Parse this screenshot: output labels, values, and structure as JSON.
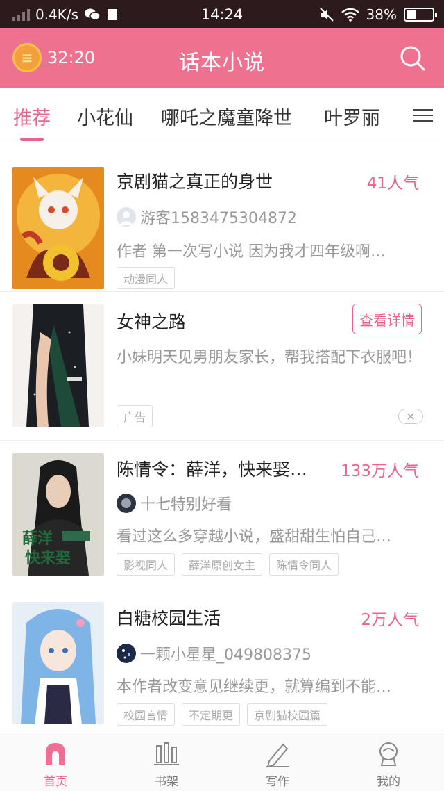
{
  "status_bar": {
    "net_speed": "0.4K/s",
    "time": "14:24",
    "battery": "38%",
    "battery_level": 0.38
  },
  "header": {
    "timer": "32:20",
    "title": "话本小说",
    "accent_color": "#ee7290"
  },
  "tabs": [
    {
      "label": "推荐",
      "active": true
    },
    {
      "label": "小花仙"
    },
    {
      "label": "哪吒之魔童降世"
    },
    {
      "label": "叶罗丽"
    }
  ],
  "stories": [
    {
      "title": "京剧猫之真正的身世",
      "popularity": "41人气",
      "author": "游客1583475304872",
      "description": "作者 第一次写小说 因为我才四年级啊…",
      "tags": [
        "动漫同人"
      ]
    },
    {
      "title": "陈情令：薛洋，快来娶…",
      "popularity": "133万人气",
      "author": "十七特别好看",
      "description": "看过这么多穿越小说，盛甜甜生怕自己…",
      "tags": [
        "影视同人",
        "薛洋原创女主",
        "陈情令同人"
      ]
    },
    {
      "title": "白糖校园生活",
      "popularity": "2万人气",
      "author": "一颗小星星_049808375",
      "description": "本作者改变意见继续更，就算编到不能…",
      "tags": [
        "校园言情",
        "不定期更",
        "京剧猫校园篇"
      ]
    }
  ],
  "ad": {
    "title": "女神之路",
    "button": "查看详情",
    "description": "小妹明天见男朋友家长，帮我搭配下衣服吧！",
    "tag": "广告",
    "close": "✕"
  },
  "bottom_nav": [
    {
      "label": "首页",
      "icon": "home-icon",
      "active": true
    },
    {
      "label": "书架",
      "icon": "bookshelf-icon"
    },
    {
      "label": "写作",
      "icon": "pen-icon"
    },
    {
      "label": "我的",
      "icon": "profile-icon"
    }
  ]
}
